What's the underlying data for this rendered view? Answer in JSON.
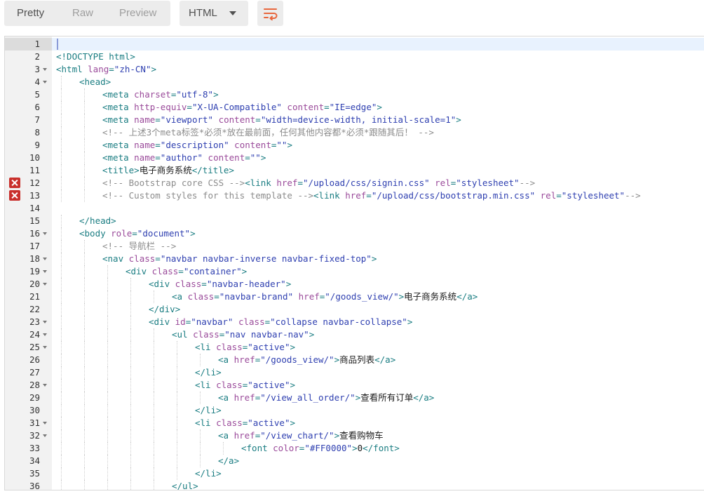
{
  "toolbar": {
    "view_tabs": [
      "Pretty",
      "Raw",
      "Preview"
    ],
    "active_tab": "Pretty",
    "format_select": "HTML",
    "wrap_icon": "wrap-lines-icon"
  },
  "colors": {
    "tag": "#1a7d82",
    "attr": "#9a4a9a",
    "value": "#2e3fb0",
    "comment": "#8c8c8c",
    "error": "#c9302c"
  },
  "editor": {
    "lines": [
      {
        "n": "1",
        "indent": 0,
        "fold": false,
        "error": false,
        "tokens": []
      },
      {
        "n": "2",
        "indent": 0,
        "fold": false,
        "error": false,
        "tokens": [
          [
            "tag",
            "<!DOCTYPE html>"
          ]
        ]
      },
      {
        "n": "3",
        "indent": 0,
        "fold": true,
        "error": false,
        "tokens": [
          [
            "tag",
            "<html "
          ],
          [
            "attr",
            "lang"
          ],
          [
            "tag",
            "="
          ],
          [
            "val",
            "\"zh-CN\""
          ],
          [
            "tag",
            ">"
          ]
        ]
      },
      {
        "n": "4",
        "indent": 1,
        "fold": true,
        "error": false,
        "tokens": [
          [
            "tag",
            "<head>"
          ]
        ]
      },
      {
        "n": "5",
        "indent": 2,
        "fold": false,
        "error": false,
        "tokens": [
          [
            "tag",
            "<meta "
          ],
          [
            "attr",
            "charset"
          ],
          [
            "tag",
            "="
          ],
          [
            "val",
            "\"utf-8\""
          ],
          [
            "tag",
            ">"
          ]
        ]
      },
      {
        "n": "6",
        "indent": 2,
        "fold": false,
        "error": false,
        "tokens": [
          [
            "tag",
            "<meta "
          ],
          [
            "attr",
            "http-equiv"
          ],
          [
            "tag",
            "="
          ],
          [
            "val",
            "\"X-UA-Compatible\""
          ],
          [
            "tag",
            " "
          ],
          [
            "attr",
            "content"
          ],
          [
            "tag",
            "="
          ],
          [
            "val",
            "\"IE=edge\""
          ],
          [
            "tag",
            ">"
          ]
        ]
      },
      {
        "n": "7",
        "indent": 2,
        "fold": false,
        "error": false,
        "tokens": [
          [
            "tag",
            "<meta "
          ],
          [
            "attr",
            "name"
          ],
          [
            "tag",
            "="
          ],
          [
            "val",
            "\"viewport\""
          ],
          [
            "tag",
            " "
          ],
          [
            "attr",
            "content"
          ],
          [
            "tag",
            "="
          ],
          [
            "val",
            "\"width=device-width, initial-scale=1\""
          ],
          [
            "tag",
            ">"
          ]
        ]
      },
      {
        "n": "8",
        "indent": 2,
        "fold": false,
        "error": false,
        "tokens": [
          [
            "cmt",
            "<!-- 上述3个meta标签*必须*放在最前面，任何其他内容都*必须*跟随其后！ -->"
          ]
        ]
      },
      {
        "n": "9",
        "indent": 2,
        "fold": false,
        "error": false,
        "tokens": [
          [
            "tag",
            "<meta "
          ],
          [
            "attr",
            "name"
          ],
          [
            "tag",
            "="
          ],
          [
            "val",
            "\"description\""
          ],
          [
            "tag",
            " "
          ],
          [
            "attr",
            "content"
          ],
          [
            "tag",
            "="
          ],
          [
            "val",
            "\"\""
          ],
          [
            "tag",
            ">"
          ]
        ]
      },
      {
        "n": "10",
        "indent": 2,
        "fold": false,
        "error": false,
        "tokens": [
          [
            "tag",
            "<meta "
          ],
          [
            "attr",
            "name"
          ],
          [
            "tag",
            "="
          ],
          [
            "val",
            "\"author\""
          ],
          [
            "tag",
            " "
          ],
          [
            "attr",
            "content"
          ],
          [
            "tag",
            "="
          ],
          [
            "val",
            "\"\""
          ],
          [
            "tag",
            ">"
          ]
        ]
      },
      {
        "n": "11",
        "indent": 2,
        "fold": false,
        "error": false,
        "tokens": [
          [
            "tag",
            "<title>"
          ],
          [
            "txt",
            "电子商务系统"
          ],
          [
            "tag",
            "</title>"
          ]
        ]
      },
      {
        "n": "12",
        "indent": 2,
        "fold": false,
        "error": true,
        "tokens": [
          [
            "cmt",
            "<!-- Bootstrap core CSS -->"
          ],
          [
            "tag",
            "<link "
          ],
          [
            "attr",
            "href"
          ],
          [
            "tag",
            "="
          ],
          [
            "val",
            "\"/upload/css/signin.css\""
          ],
          [
            "tag",
            " "
          ],
          [
            "attr",
            "rel"
          ],
          [
            "tag",
            "="
          ],
          [
            "val",
            "\"stylesheet\""
          ],
          [
            "cmt",
            "-->"
          ]
        ]
      },
      {
        "n": "13",
        "indent": 2,
        "fold": false,
        "error": true,
        "tokens": [
          [
            "cmt",
            "<!-- Custom styles for this template -->"
          ],
          [
            "tag",
            "<link "
          ],
          [
            "attr",
            "href"
          ],
          [
            "tag",
            "="
          ],
          [
            "val",
            "\"/upload/css/bootstrap.min.css\""
          ],
          [
            "tag",
            " "
          ],
          [
            "attr",
            "rel"
          ],
          [
            "tag",
            "="
          ],
          [
            "val",
            "\"stylesheet\""
          ],
          [
            "cmt",
            "-->"
          ]
        ]
      },
      {
        "n": "14",
        "indent": 0,
        "fold": false,
        "error": false,
        "tokens": []
      },
      {
        "n": "15",
        "indent": 1,
        "fold": false,
        "error": false,
        "tokens": [
          [
            "tag",
            "</head>"
          ]
        ]
      },
      {
        "n": "16",
        "indent": 1,
        "fold": true,
        "error": false,
        "tokens": [
          [
            "tag",
            "<body "
          ],
          [
            "attr",
            "role"
          ],
          [
            "tag",
            "="
          ],
          [
            "val",
            "\"document\""
          ],
          [
            "tag",
            ">"
          ]
        ]
      },
      {
        "n": "17",
        "indent": 2,
        "fold": false,
        "error": false,
        "tokens": [
          [
            "cmt",
            "<!-- 导航栏 -->"
          ]
        ]
      },
      {
        "n": "18",
        "indent": 2,
        "fold": true,
        "error": false,
        "tokens": [
          [
            "tag",
            "<nav "
          ],
          [
            "attr",
            "class"
          ],
          [
            "tag",
            "="
          ],
          [
            "val",
            "\"navbar navbar-inverse navbar-fixed-top\""
          ],
          [
            "tag",
            ">"
          ]
        ]
      },
      {
        "n": "19",
        "indent": 3,
        "fold": true,
        "error": false,
        "tokens": [
          [
            "tag",
            "<div "
          ],
          [
            "attr",
            "class"
          ],
          [
            "tag",
            "="
          ],
          [
            "val",
            "\"container\""
          ],
          [
            "tag",
            ">"
          ]
        ]
      },
      {
        "n": "20",
        "indent": 4,
        "fold": true,
        "error": false,
        "tokens": [
          [
            "tag",
            "<div "
          ],
          [
            "attr",
            "class"
          ],
          [
            "tag",
            "="
          ],
          [
            "val",
            "\"navbar-header\""
          ],
          [
            "tag",
            ">"
          ]
        ]
      },
      {
        "n": "21",
        "indent": 5,
        "fold": false,
        "error": false,
        "tokens": [
          [
            "tag",
            "<a "
          ],
          [
            "attr",
            "class"
          ],
          [
            "tag",
            "="
          ],
          [
            "val",
            "\"navbar-brand\""
          ],
          [
            "tag",
            " "
          ],
          [
            "attr",
            "href"
          ],
          [
            "tag",
            "="
          ],
          [
            "val",
            "\"/goods_view/\""
          ],
          [
            "tag",
            ">"
          ],
          [
            "txt",
            "电子商务系统"
          ],
          [
            "tag",
            "</a>"
          ]
        ]
      },
      {
        "n": "22",
        "indent": 4,
        "fold": false,
        "error": false,
        "tokens": [
          [
            "tag",
            "</div>"
          ]
        ]
      },
      {
        "n": "23",
        "indent": 4,
        "fold": true,
        "error": false,
        "tokens": [
          [
            "tag",
            "<div "
          ],
          [
            "attr",
            "id"
          ],
          [
            "tag",
            "="
          ],
          [
            "val",
            "\"navbar\""
          ],
          [
            "tag",
            " "
          ],
          [
            "attr",
            "class"
          ],
          [
            "tag",
            "="
          ],
          [
            "val",
            "\"collapse navbar-collapse\""
          ],
          [
            "tag",
            ">"
          ]
        ]
      },
      {
        "n": "24",
        "indent": 5,
        "fold": true,
        "error": false,
        "tokens": [
          [
            "tag",
            "<ul "
          ],
          [
            "attr",
            "class"
          ],
          [
            "tag",
            "="
          ],
          [
            "val",
            "\"nav navbar-nav\""
          ],
          [
            "tag",
            ">"
          ]
        ]
      },
      {
        "n": "25",
        "indent": 6,
        "fold": true,
        "error": false,
        "tokens": [
          [
            "tag",
            "<li "
          ],
          [
            "attr",
            "class"
          ],
          [
            "tag",
            "="
          ],
          [
            "val",
            "\"active\""
          ],
          [
            "tag",
            ">"
          ]
        ]
      },
      {
        "n": "26",
        "indent": 7,
        "fold": false,
        "error": false,
        "tokens": [
          [
            "tag",
            "<a "
          ],
          [
            "attr",
            "href"
          ],
          [
            "tag",
            "="
          ],
          [
            "val",
            "\"/goods_view/\""
          ],
          [
            "tag",
            ">"
          ],
          [
            "txt",
            "商品列表"
          ],
          [
            "tag",
            "</a>"
          ]
        ]
      },
      {
        "n": "27",
        "indent": 6,
        "fold": false,
        "error": false,
        "tokens": [
          [
            "tag",
            "</li>"
          ]
        ]
      },
      {
        "n": "28",
        "indent": 6,
        "fold": true,
        "error": false,
        "tokens": [
          [
            "tag",
            "<li "
          ],
          [
            "attr",
            "class"
          ],
          [
            "tag",
            "="
          ],
          [
            "val",
            "\"active\""
          ],
          [
            "tag",
            ">"
          ]
        ]
      },
      {
        "n": "29",
        "indent": 7,
        "fold": false,
        "error": false,
        "tokens": [
          [
            "tag",
            "<a "
          ],
          [
            "attr",
            "href"
          ],
          [
            "tag",
            "="
          ],
          [
            "val",
            "\"/view_all_order/\""
          ],
          [
            "tag",
            ">"
          ],
          [
            "txt",
            "查看所有订单"
          ],
          [
            "tag",
            "</a>"
          ]
        ]
      },
      {
        "n": "30",
        "indent": 6,
        "fold": false,
        "error": false,
        "tokens": [
          [
            "tag",
            "</li>"
          ]
        ]
      },
      {
        "n": "31",
        "indent": 6,
        "fold": true,
        "error": false,
        "tokens": [
          [
            "tag",
            "<li "
          ],
          [
            "attr",
            "class"
          ],
          [
            "tag",
            "="
          ],
          [
            "val",
            "\"active\""
          ],
          [
            "tag",
            ">"
          ]
        ]
      },
      {
        "n": "32",
        "indent": 7,
        "fold": true,
        "error": false,
        "tokens": [
          [
            "tag",
            "<a "
          ],
          [
            "attr",
            "href"
          ],
          [
            "tag",
            "="
          ],
          [
            "val",
            "\"/view_chart/\""
          ],
          [
            "tag",
            ">"
          ],
          [
            "txt",
            "查看购物车"
          ]
        ]
      },
      {
        "n": "33",
        "indent": 8,
        "fold": false,
        "error": false,
        "tokens": [
          [
            "tag",
            "<font "
          ],
          [
            "attr",
            "color"
          ],
          [
            "tag",
            "="
          ],
          [
            "val",
            "\"#FF0000\""
          ],
          [
            "tag",
            ">"
          ],
          [
            "txt",
            "0"
          ],
          [
            "tag",
            "</font>"
          ]
        ]
      },
      {
        "n": "34",
        "indent": 7,
        "fold": false,
        "error": false,
        "tokens": [
          [
            "tag",
            "</a>"
          ]
        ]
      },
      {
        "n": "35",
        "indent": 6,
        "fold": false,
        "error": false,
        "tokens": [
          [
            "tag",
            "</li>"
          ]
        ]
      },
      {
        "n": "36",
        "indent": 5,
        "fold": false,
        "error": false,
        "tokens": [
          [
            "tag",
            "</ul>"
          ]
        ]
      }
    ]
  }
}
